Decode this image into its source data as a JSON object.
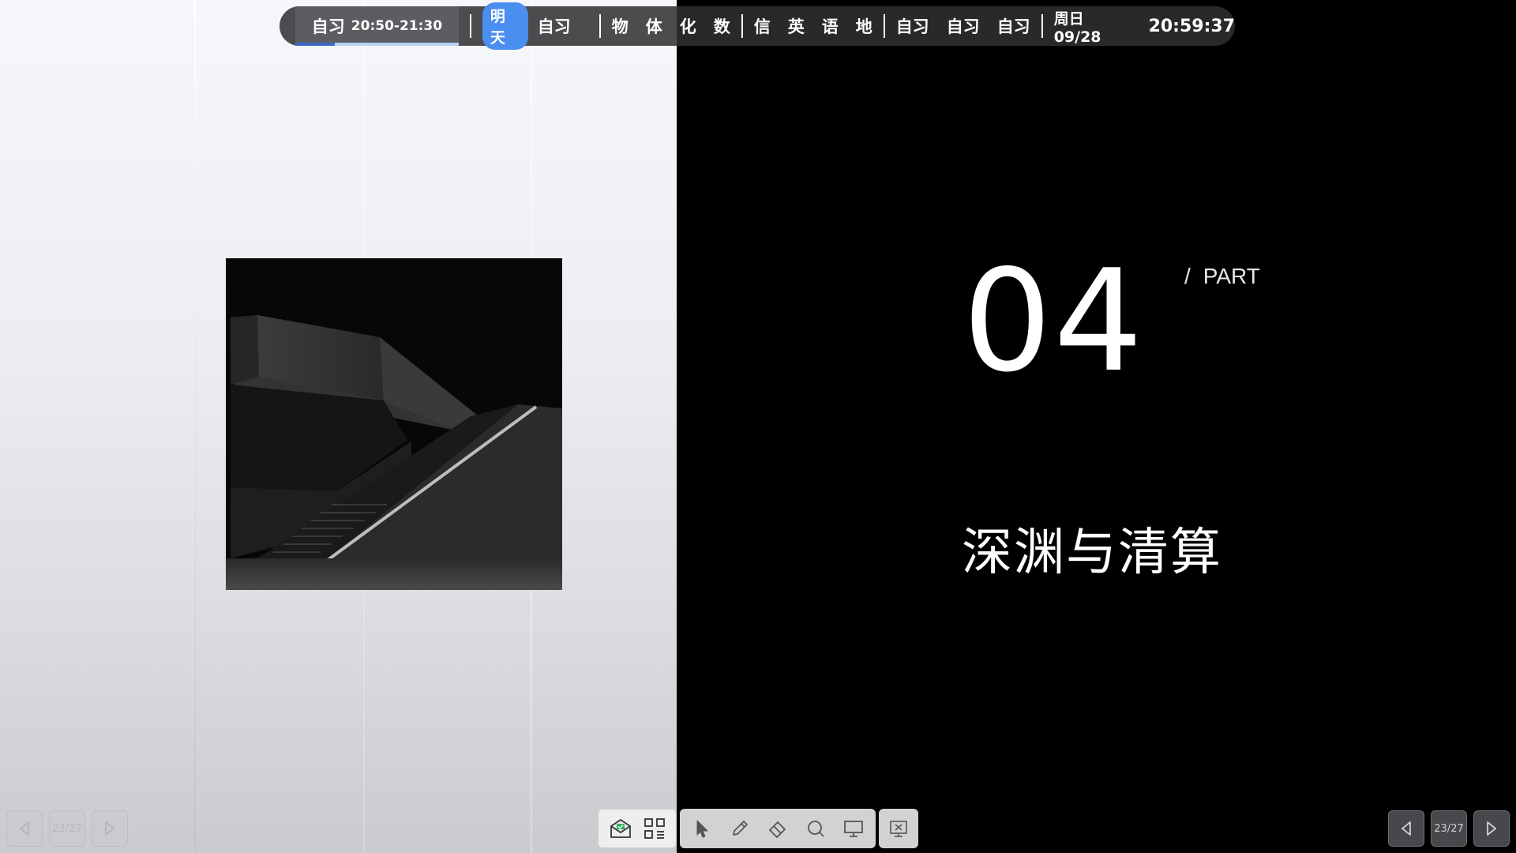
{
  "schedule": {
    "current": {
      "subject": "自习",
      "time": "20:50-21:30",
      "progress_fraction": 0.24
    },
    "tomorrow_chip": "明天",
    "groups": [
      [
        "自习"
      ],
      [
        "物",
        "体",
        "化",
        "数"
      ],
      [
        "信",
        "英",
        "语",
        "地"
      ],
      [
        "自习",
        "自习",
        "自习"
      ]
    ],
    "date": "周日 09/28",
    "clock": "20:59:37"
  },
  "slide": {
    "number": "04",
    "part_slash": "/",
    "part_label": "PART",
    "title": "深渊与清算"
  },
  "nav": {
    "left_page": "23/27",
    "right_page": "23/27"
  },
  "icons": {
    "left_prev": "triangle-left-icon",
    "left_next": "triangle-right-icon",
    "apps": [
      "mail-icon",
      "apps-grid-icon"
    ],
    "tools": [
      "cursor-icon",
      "pen-icon",
      "eraser-icon",
      "search-icon",
      "screen-icon"
    ],
    "close": "close-slideshow-icon"
  },
  "colors": {
    "accent_chip": "#4a8ef0",
    "progress_fill": "#3d68c9",
    "progress_track": "#b8d2f5",
    "bar_bg": "#303032",
    "slide_bg": "#000000"
  }
}
